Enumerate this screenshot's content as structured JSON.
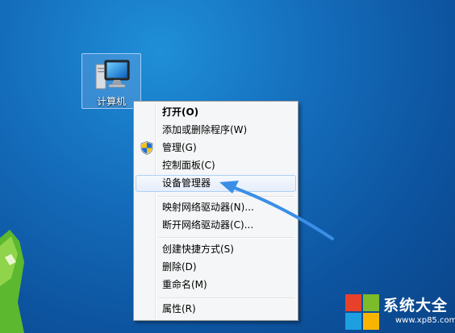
{
  "desktop": {
    "icon": {
      "label": "计算机",
      "icon": "computer-icon"
    }
  },
  "context_menu": {
    "items": [
      {
        "label": "打开(O)",
        "bold": true
      },
      {
        "label": "添加或删除程序(W)"
      },
      {
        "label": "管理(G)",
        "icon": "uac-shield-icon"
      },
      {
        "label": "控制面板(C)"
      },
      {
        "label": "设备管理器",
        "highlighted": true
      },
      {
        "label": "映射网络驱动器(N)..."
      },
      {
        "label": "断开网络驱动器(C)..."
      },
      {
        "label": "创建快捷方式(S)"
      },
      {
        "label": "删除(D)"
      },
      {
        "label": "重命名(M)"
      },
      {
        "label": "属性(R)"
      }
    ]
  },
  "watermark": {
    "name": "系统大全",
    "url": "www.xp85.com",
    "colors": [
      "#e8412b",
      "#7cbb2a",
      "#1d9fe0",
      "#f7b500"
    ]
  },
  "annotation": {
    "arrow_color": "#3a8ee6"
  }
}
